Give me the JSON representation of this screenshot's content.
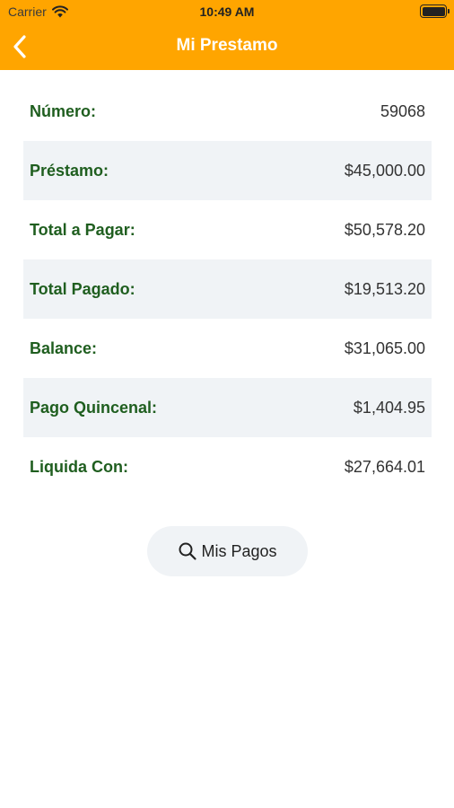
{
  "status_bar": {
    "carrier": "Carrier",
    "time": "10:49 AM"
  },
  "nav": {
    "title": "Mi Prestamo",
    "back_icon": "chevron-left-icon"
  },
  "colors": {
    "header": "#FFA500",
    "label_green": "#1F5E1F",
    "row_alt": "#F0F3F6"
  },
  "details": [
    {
      "label": "Número:",
      "value": "59068"
    },
    {
      "label": "Préstamo:",
      "value": "$45,000.00"
    },
    {
      "label": "Total a Pagar:",
      "value": "$50,578.20"
    },
    {
      "label": "Total Pagado:",
      "value": "$19,513.20"
    },
    {
      "label": "Balance:",
      "value": "$31,065.00"
    },
    {
      "label": "Pago Quincenal:",
      "value": "$1,404.95"
    },
    {
      "label": "Liquida Con:",
      "value": "$27,664.01"
    }
  ],
  "actions": {
    "payments_button": "Mis Pagos",
    "payments_icon": "search-icon"
  }
}
